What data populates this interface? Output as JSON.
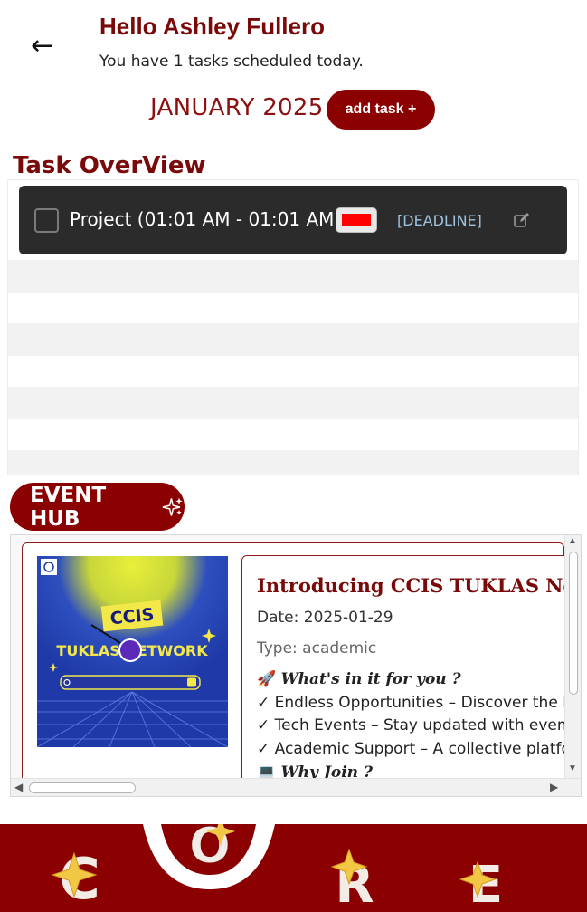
{
  "header": {
    "greeting": "Hello Ashley Fullero",
    "subtitle": "You have 1 tasks scheduled today.",
    "back_icon": "left-arrow-icon"
  },
  "calendar": {
    "month_label": "JANUARY 2025",
    "add_task_label": "add task +"
  },
  "overview": {
    "title": "Task OverView",
    "tasks": [
      {
        "label": "Project (01:01 AM - 01:01 AM)",
        "color": "#ff0000",
        "tag": "[DEADLINE]",
        "completed": false
      }
    ]
  },
  "events": {
    "hub_label": "EVENT HUB",
    "items": [
      {
        "poster_top": "CCIS",
        "poster_bottom": "TUKLAS NETWORK",
        "title": "Introducing CCIS TUKLAS Network",
        "date": "Date: 2025-01-29",
        "type": "Type: academic",
        "lines": [
          {
            "icon": "rocket-icon",
            "text": "What's in it for you ?"
          },
          {
            "icon": "check-icon",
            "text": "Endless Opportunities – Discover the lat"
          },
          {
            "icon": "check-icon",
            "text": "Tech Events – Stay updated with events"
          },
          {
            "icon": "check-icon",
            "text": "Academic Support – A collective platfor"
          },
          {
            "icon": "laptop-icon",
            "text": "Why Join ?"
          }
        ]
      }
    ]
  },
  "footer": {
    "brand_letters": [
      "C",
      "O",
      "R",
      "E"
    ]
  },
  "colors": {
    "brand": "#8b0000",
    "accent_gold": "#f2c744",
    "task_card": "#2b2b2b"
  }
}
